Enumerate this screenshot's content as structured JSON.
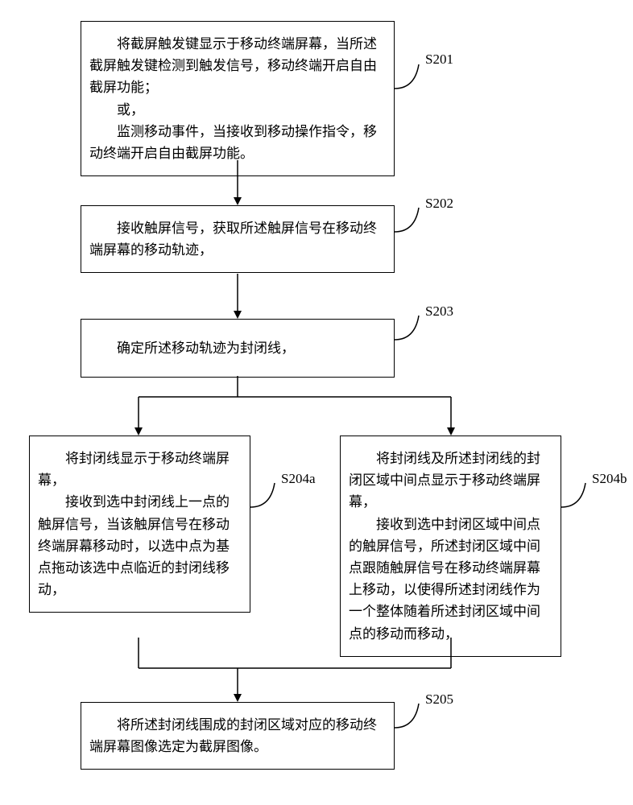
{
  "chart_data": {
    "type": "flowchart",
    "nodes": [
      {
        "id": "S201",
        "text_lines": [
          "将截屏触发键显示于移动终端屏幕，当所述截屏触发键检测到触发信号，移动终端开启自由截屏功能；",
          "或，",
          "监测移动事件，当接收到移动操作指令，移动终端开启自由截屏功能。"
        ]
      },
      {
        "id": "S202",
        "text_lines": [
          "接收触屏信号，获取所述触屏信号在移动终端屏幕的移动轨迹，"
        ]
      },
      {
        "id": "S203",
        "text_lines": [
          "确定所述移动轨迹为封闭线，"
        ]
      },
      {
        "id": "S204a",
        "text_lines": [
          "将封闭线显示于移动终端屏幕，",
          "接收到选中封闭线上一点的触屏信号，当该触屏信号在移动终端屏幕移动时，以选中点为基点拖动该选中点临近的封闭线移动，"
        ]
      },
      {
        "id": "S204b",
        "text_lines": [
          "将封闭线及所述封闭线的封闭区域中间点显示于移动终端屏幕，",
          "接收到选中封闭区域中间点的触屏信号，所述封闭区域中间点跟随触屏信号在移动终端屏幕上移动，以使得所述封闭线作为一个整体随着所述封闭区域中间点的移动而移动，"
        ]
      },
      {
        "id": "S205",
        "text_lines": [
          "将所述封闭线围成的封闭区域对应的移动终端屏幕图像选定为截屏图像。"
        ]
      }
    ],
    "edges": [
      {
        "from": "S201",
        "to": "S202"
      },
      {
        "from": "S202",
        "to": "S203"
      },
      {
        "from": "S203",
        "to": "S204a"
      },
      {
        "from": "S203",
        "to": "S204b"
      },
      {
        "from": "S204a",
        "to": "S205"
      },
      {
        "from": "S204b",
        "to": "S205"
      }
    ]
  },
  "nodes": {
    "s201": {
      "p1": "将截屏触发键显示于移动终端屏幕，当所述截屏触发键检测到触发信号，移动终端开启自由截屏功能；",
      "p2": "或，",
      "p3": "监测移动事件，当接收到移动操作指令，移动终端开启自由截屏功能。"
    },
    "s202": {
      "p1": "接收触屏信号，获取所述触屏信号在移动终端屏幕的移动轨迹，"
    },
    "s203": {
      "p1": "确定所述移动轨迹为封闭线，"
    },
    "s204a": {
      "p1": "将封闭线显示于移动终端屏幕，",
      "p2": "接收到选中封闭线上一点的触屏信号，当该触屏信号在移动终端屏幕移动时，以选中点为基点拖动该选中点临近的封闭线移动，"
    },
    "s204b": {
      "p1": "将封闭线及所述封闭线的封闭区域中间点显示于移动终端屏幕，",
      "p2": "接收到选中封闭区域中间点的触屏信号，所述封闭区域中间点跟随触屏信号在移动终端屏幕上移动，以使得所述封闭线作为一个整体随着所述封闭区域中间点的移动而移动，"
    },
    "s205": {
      "p1": "将所述封闭线围成的封闭区域对应的移动终端屏幕图像选定为截屏图像。"
    }
  },
  "labels": {
    "s201": "S201",
    "s202": "S202",
    "s203": "S203",
    "s204a": "S204a",
    "s204b": "S204b",
    "s205": "S205"
  }
}
